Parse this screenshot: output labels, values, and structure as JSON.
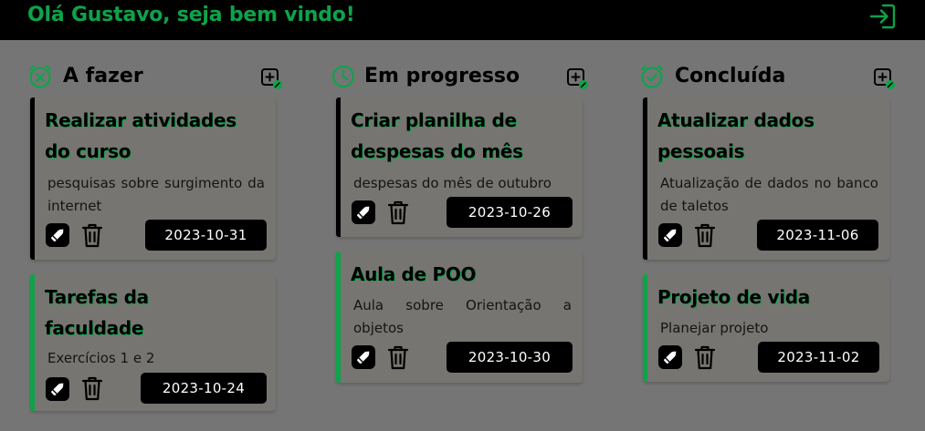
{
  "header": {
    "greeting": "Olá Gustavo, seja bem vindo!",
    "logout_icon": "logout-icon"
  },
  "colors": {
    "accent": "#0ea34a",
    "background": "#757575",
    "card": "#777571",
    "topbar": "#000000"
  },
  "columns": [
    {
      "title": "A fazer",
      "icon": "x-circle-icon",
      "add_icon": "add-task-icon",
      "cards": [
        {
          "title": "Realizar atividades do curso",
          "description": "pesquisas sobre surgimento da internet",
          "date": "2023-10-31",
          "status_bar": "black"
        },
        {
          "title": "Tarefas da faculdade",
          "description": "Exercícios 1 e 2",
          "date": "2023-10-24",
          "status_bar": "green"
        }
      ]
    },
    {
      "title": "Em progresso",
      "icon": "clock-icon",
      "add_icon": "add-task-icon",
      "cards": [
        {
          "title": "Criar planilha de despesas do mês",
          "description": "despesas do mês de outubro",
          "date": "2023-10-26",
          "status_bar": "black"
        },
        {
          "title": "Aula de POO",
          "description": "Aula sobre Orientação a objetos",
          "date": "2023-10-30",
          "status_bar": "green"
        }
      ]
    },
    {
      "title": "Concluída",
      "icon": "check-circle-icon",
      "add_icon": "add-task-icon",
      "cards": [
        {
          "title": "Atualizar dados pessoais",
          "description": "Atualização de dados no banco de taletos",
          "date": "2023-11-06",
          "status_bar": "black"
        },
        {
          "title": "Projeto de vida",
          "description": "Planejar projeto",
          "date": "2023-11-02",
          "status_bar": "green"
        }
      ]
    }
  ]
}
